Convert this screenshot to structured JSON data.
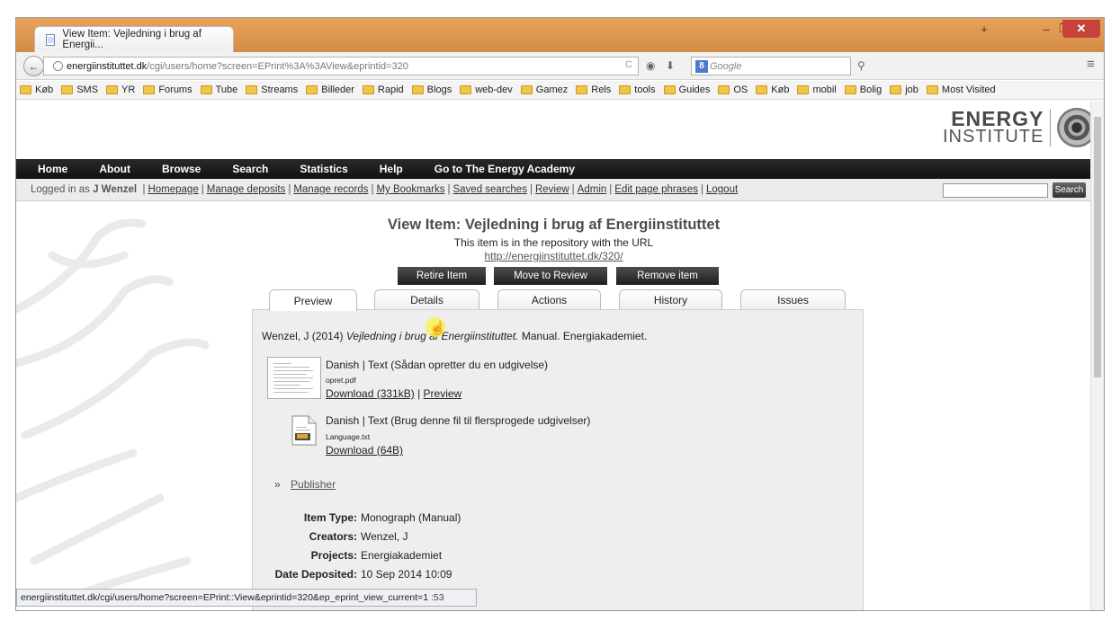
{
  "browser": {
    "tab_title": "View Item: Vejledning i brug af Energii...",
    "url_domain": "energiinstituttet.dk",
    "url_path": "/cgi/users/home?screen=EPrint%3A%3AView&eprintid=320",
    "search_placeholder": "Google",
    "search_engine_icon": "8",
    "bookmarks": [
      "Køb",
      "SMS",
      "YR",
      "Forums",
      "Tube",
      "Streams",
      "Billeder",
      "Rapid",
      "Blogs",
      "web-dev",
      "Gamez",
      "Rels",
      "tools",
      "Guides",
      "OS",
      "Køb",
      "mobil",
      "Bolig",
      "job",
      "Most Visited"
    ],
    "status_url": "energiinstituttet.dk/cgi/users/home?screen=EPrint::View&eprintid=320&ep_eprint_view_current=1",
    "min_symbol": "–",
    "max_symbol": "❐",
    "close_symbol": "✕",
    "plus_symbol": "+",
    "back_symbol": "←",
    "reload_symbol": "C",
    "menu_symbol": "≡"
  },
  "logo": {
    "line1": "ENERGY",
    "line2": "INSTITUTE"
  },
  "menu": [
    "Home",
    "About",
    "Browse",
    "Search",
    "Statistics",
    "Help",
    "Go to The Energy Academy"
  ],
  "userbar": {
    "prefix": "Logged in as",
    "user": "J Wenzel",
    "links": [
      "Homepage",
      "Manage deposits",
      "Manage records",
      "My Bookmarks",
      "Saved searches",
      "Review",
      "Admin",
      "Edit page phrases",
      "Logout"
    ],
    "search_button": "Search"
  },
  "page": {
    "title": "View Item: Vejledning i brug af Energiinstituttet",
    "subtitle": "This item is in the repository with the URL",
    "url": "http://energiinstituttet.dk/320/",
    "actions": [
      "Retire Item",
      "Move to Review",
      "Remove item"
    ],
    "tabs": [
      "Preview",
      "Details",
      "Actions",
      "History",
      "Issues"
    ]
  },
  "preview": {
    "citation_pre": "Wenzel, J (2014)",
    "citation_title": "Vejledning i brug af Energiinstituttet.",
    "citation_post": "Manual. Energiakademiet.",
    "docs": [
      {
        "title": "Danish | Text (Sådan opretter du en udgivelse)",
        "file": "opret.pdf",
        "download": "Download (331kB)",
        "preview": "Preview",
        "sep": "|"
      },
      {
        "title": "Danish | Text (Brug denne fil til flersprogede udgivelser)",
        "file": "Language.txt",
        "download": "Download (64B)"
      }
    ],
    "publisher_label": "Publisher",
    "publisher_arrow": "»",
    "meta": [
      {
        "label": "Item Type:",
        "value": "Monograph (Manual)"
      },
      {
        "label": "Creators:",
        "value": "Wenzel, J"
      },
      {
        "label": "Projects:",
        "value": "Energiakademiet"
      },
      {
        "label": "Date Deposited:",
        "value": "10 Sep 2014 10:09"
      }
    ],
    "partial_value": ":53"
  }
}
